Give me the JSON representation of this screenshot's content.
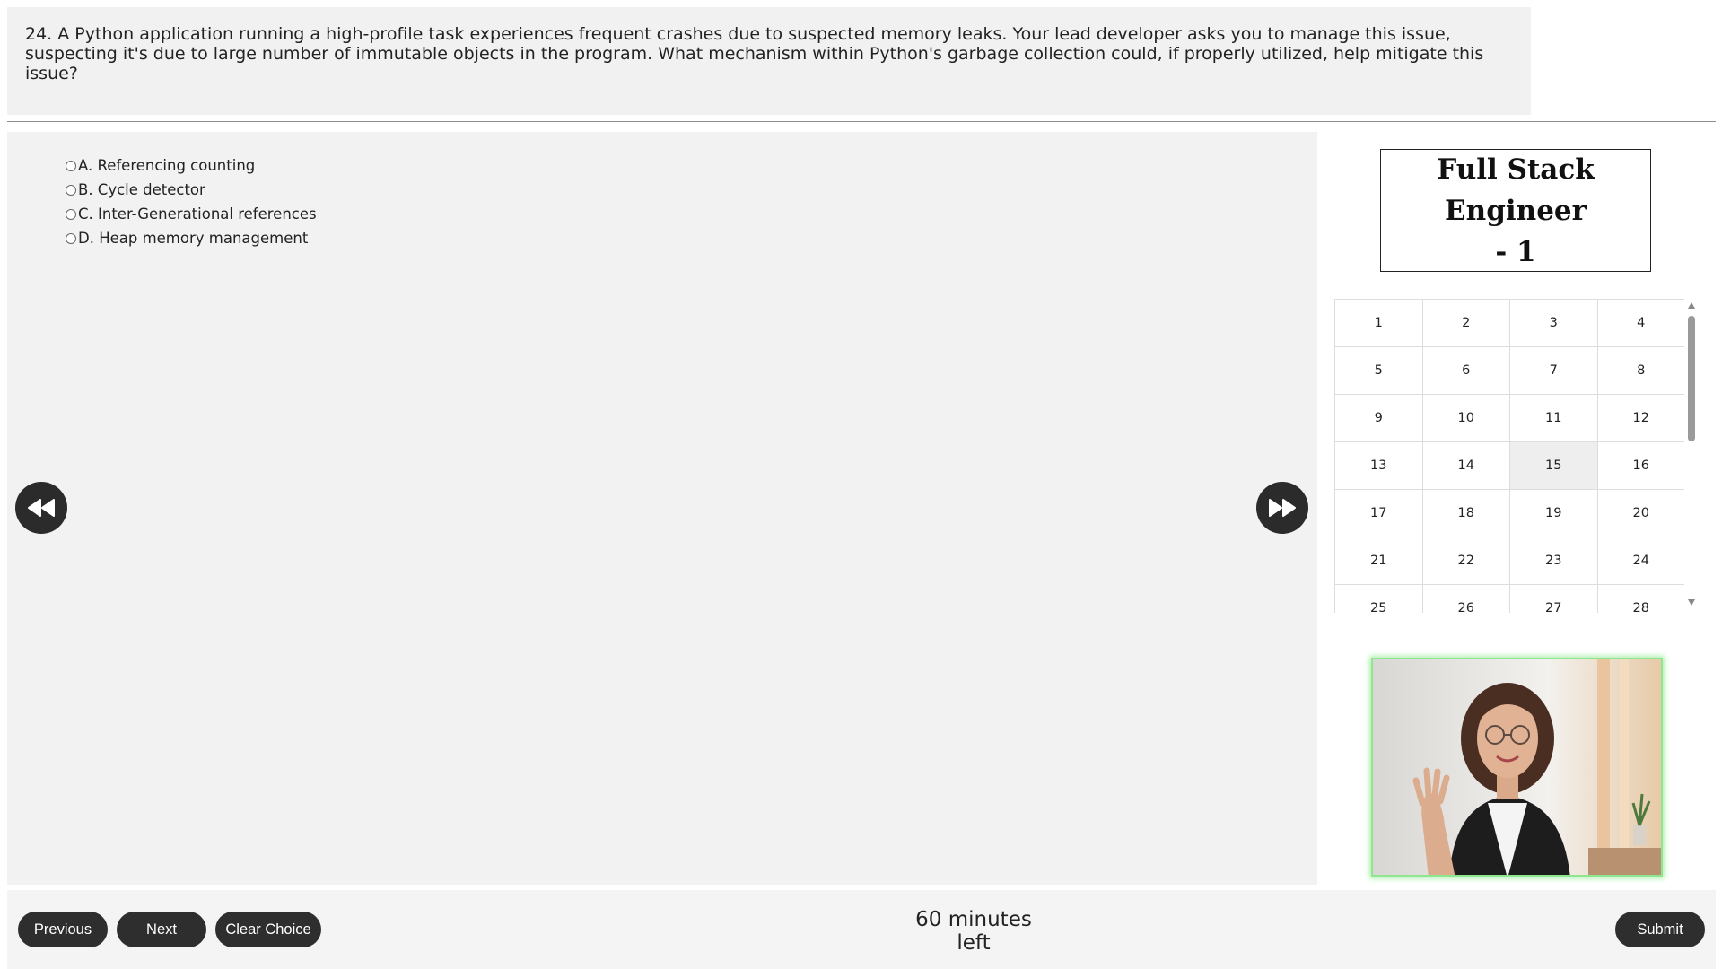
{
  "question": {
    "text": "24. A Python application running a high-profile task experiences frequent crashes due to suspected memory leaks. Your lead developer asks you to manage this issue, suspecting it's due to large number of immutable objects in the program. What mechanism within Python's garbage collection could, if properly utilized, help mitigate this issue?"
  },
  "options": [
    {
      "label": "A. Referencing counting",
      "selected": false
    },
    {
      "label": "B. Cycle detector",
      "selected": false
    },
    {
      "label": "C. Inter-Generational references",
      "selected": false
    },
    {
      "label": "D. Heap memory management",
      "selected": false
    }
  ],
  "exam": {
    "title_line1": "Full Stack Engineer",
    "title_line2": "- 1"
  },
  "question_grid": {
    "items": [
      "1",
      "2",
      "3",
      "4",
      "5",
      "6",
      "7",
      "8",
      "9",
      "10",
      "11",
      "12",
      "13",
      "14",
      "15",
      "16",
      "17",
      "18",
      "19",
      "20",
      "21",
      "22",
      "23",
      "24",
      "25",
      "26",
      "27",
      "28"
    ],
    "highlighted": "15"
  },
  "footer": {
    "previous_label": "Previous",
    "next_label": "Next",
    "clear_label": "Clear Choice",
    "timer_text": "60 minutes left",
    "submit_label": "Submit"
  },
  "icons": {
    "prev_arrow": "rewind-icon",
    "next_arrow": "fast-forward-icon"
  },
  "colors": {
    "button_bg": "#2e2e2e",
    "panel_bg": "#f2f2f2",
    "webcam_border": "#8ee68e"
  }
}
